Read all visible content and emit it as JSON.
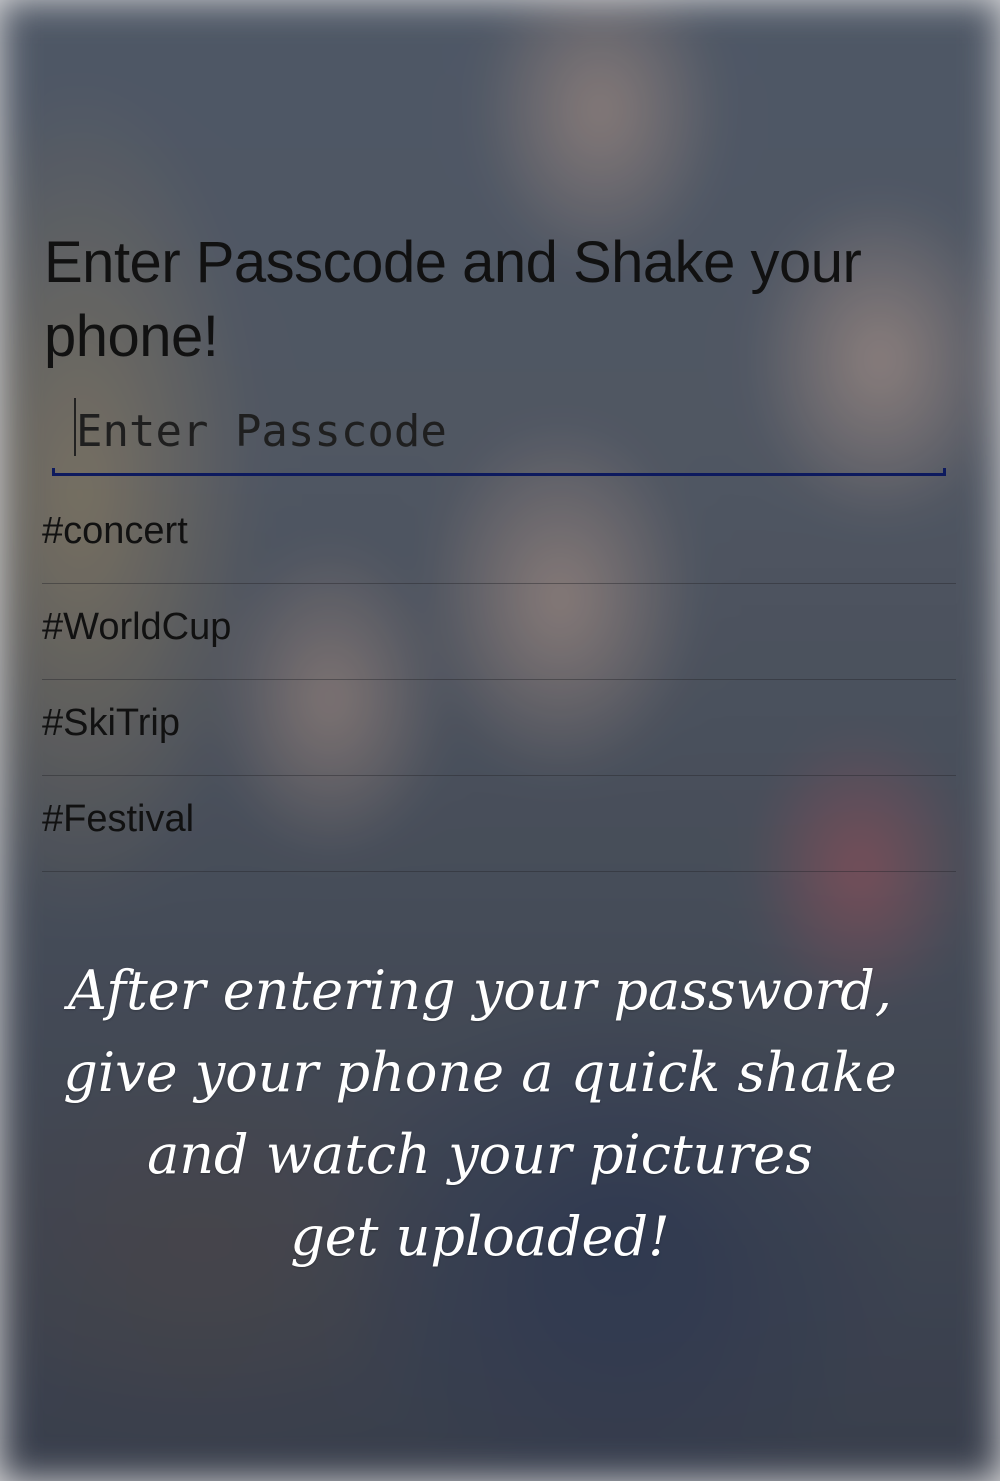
{
  "header": {
    "title": "Enter Passcode and Shake your phone!"
  },
  "passcode_field": {
    "placeholder": "Enter Passcode",
    "value": ""
  },
  "hashtags": [
    {
      "label": "#concert"
    },
    {
      "label": "#WorldCup"
    },
    {
      "label": "#SkiTrip"
    },
    {
      "label": "#Festival"
    }
  ],
  "instructions": {
    "lines": [
      "After entering your password,",
      "give your phone a quick shake",
      "and watch your pictures",
      "get uploaded!"
    ]
  },
  "colors": {
    "title_text": "#111111",
    "field_underline": "#0d1a5e",
    "instruction_text": "#ffffff"
  }
}
